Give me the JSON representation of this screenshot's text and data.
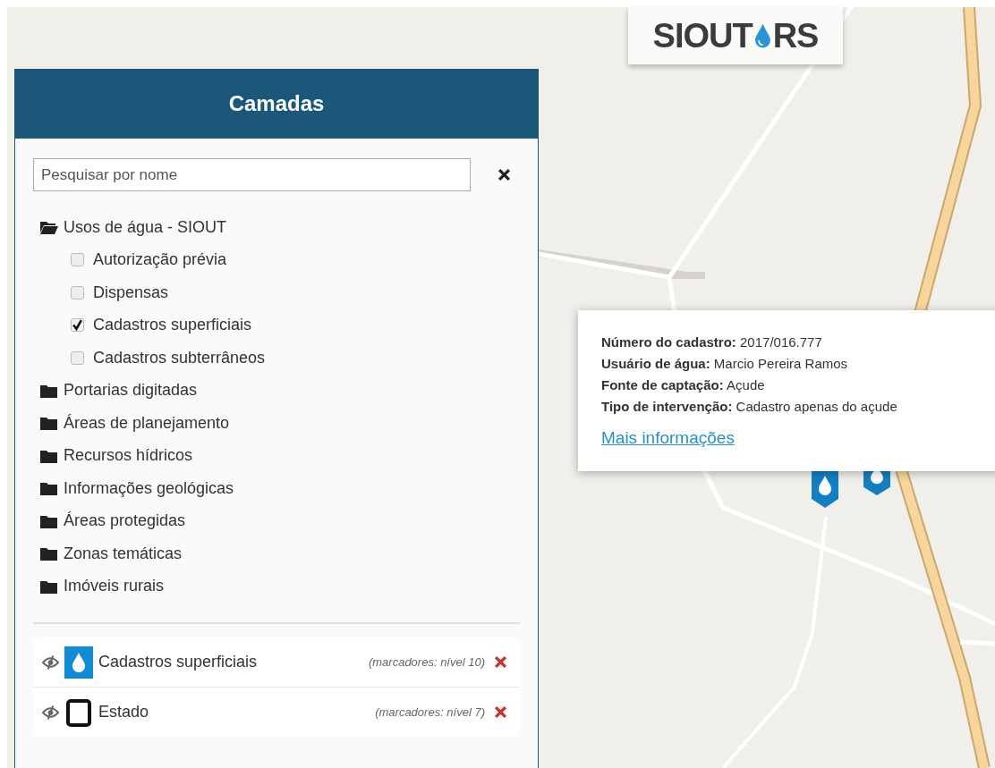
{
  "logo": {
    "parts": [
      "SIOUT",
      "RS"
    ]
  },
  "panel": {
    "title": "Camadas",
    "search": {
      "placeholder": "Pesquisar por nome"
    },
    "tree": [
      {
        "label": "Usos de água - SIOUT",
        "expanded": true,
        "children": [
          {
            "label": "Autorização prévia",
            "checked": false
          },
          {
            "label": "Dispensas",
            "checked": false
          },
          {
            "label": "Cadastros superficiais",
            "checked": true
          },
          {
            "label": "Cadastros subterrâneos",
            "checked": false
          }
        ]
      },
      {
        "label": "Portarias digitadas",
        "expanded": false
      },
      {
        "label": "Áreas de planejamento",
        "expanded": false
      },
      {
        "label": "Recursos hídricos",
        "expanded": false
      },
      {
        "label": "Informações geológicas",
        "expanded": false
      },
      {
        "label": "Áreas protegidas",
        "expanded": false
      },
      {
        "label": "Zonas temáticas",
        "expanded": false
      },
      {
        "label": "Imóveis rurais",
        "expanded": false
      }
    ],
    "active_layers": [
      {
        "name": "Cadastros superficiais",
        "kind": "drop",
        "note": "(marcadores: nível 10)"
      },
      {
        "name": "Estado",
        "kind": "outline",
        "note": "(marcadores: nível 7)"
      }
    ]
  },
  "popup": {
    "fields": [
      {
        "label": "Número do cadastro:",
        "value": "2017/016.777"
      },
      {
        "label": "Usuário de água:",
        "value": "Marcio Pereira Ramos"
      },
      {
        "label": "Fonte de captação:",
        "value": "Açude"
      },
      {
        "label": "Tipo de intervenção:",
        "value": "Cadastro apenas do açude"
      }
    ],
    "link": "Mais informações"
  }
}
